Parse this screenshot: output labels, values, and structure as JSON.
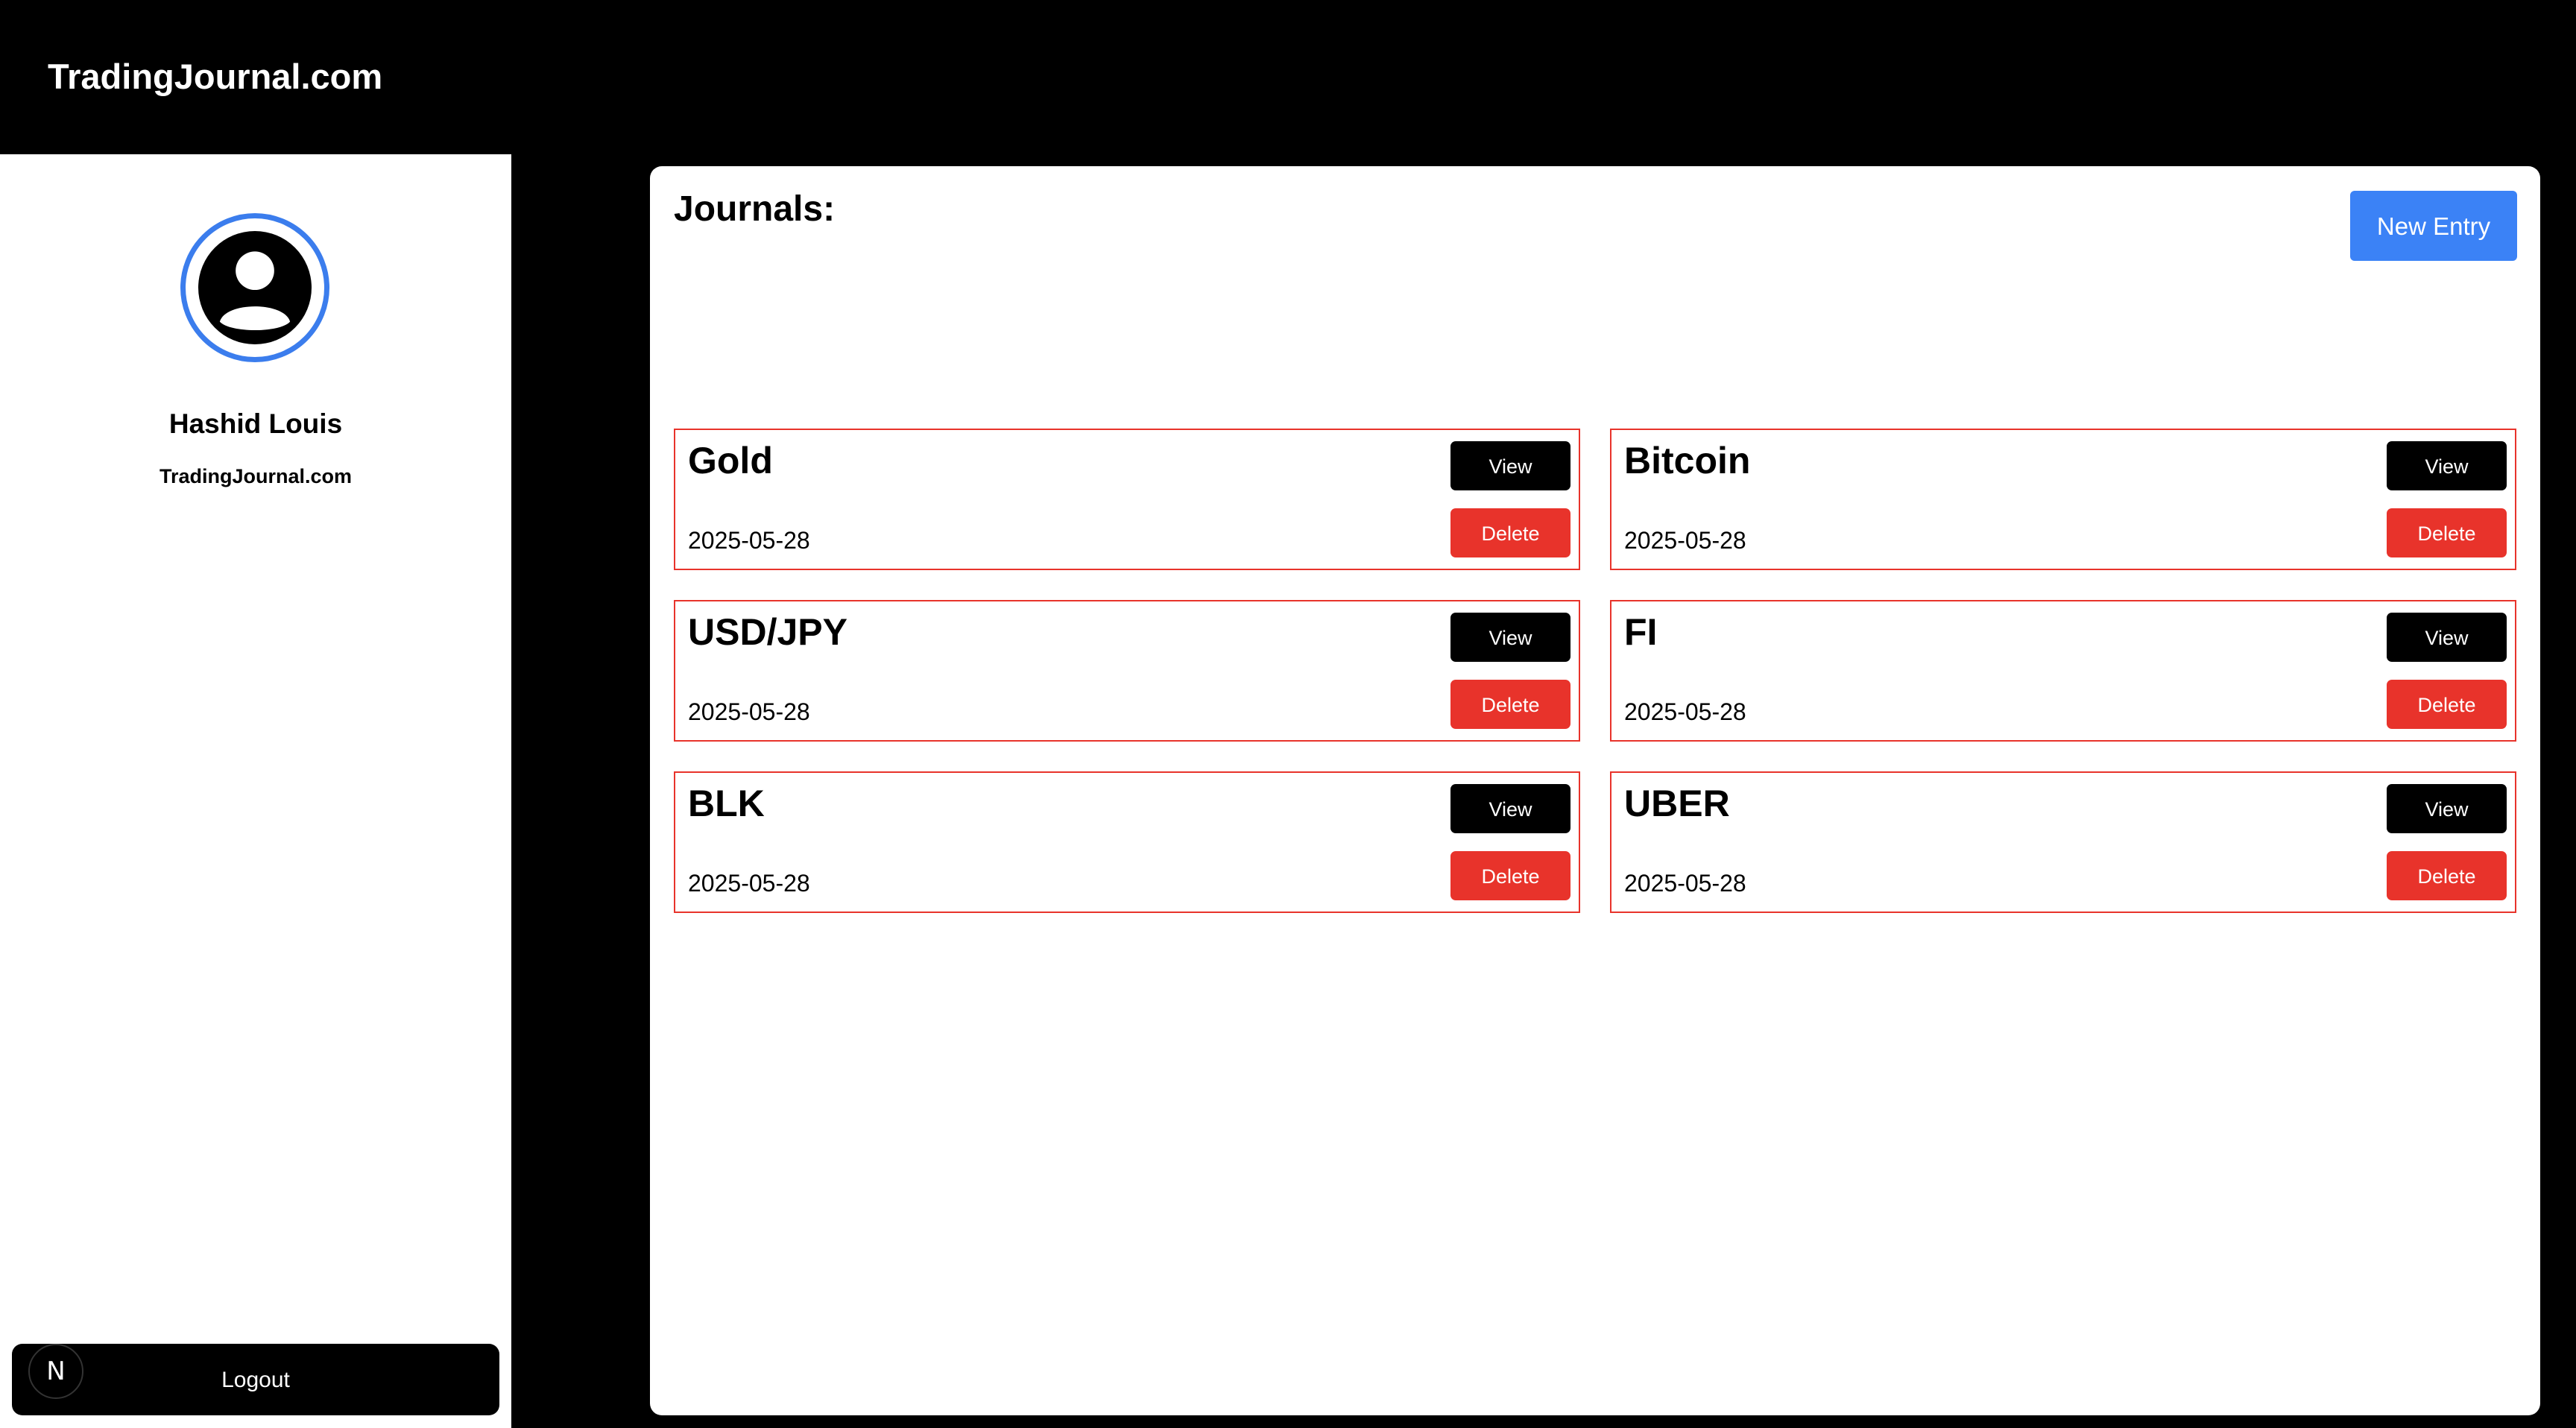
{
  "header": {
    "brand": "TradingJournal.com"
  },
  "sidebar": {
    "user_name": "Hashid Louis",
    "site": "TradingJournal.com",
    "logout_label": "Logout",
    "badge_letter": "N",
    "avatar_icon": "user-circle-icon"
  },
  "main": {
    "title": "Journals:",
    "new_entry_label": "New Entry",
    "view_label": "View",
    "delete_label": "Delete",
    "journals": [
      {
        "name": "Gold",
        "date": "2025-05-28"
      },
      {
        "name": "Bitcoin",
        "date": "2025-05-28"
      },
      {
        "name": "USD/JPY",
        "date": "2025-05-28"
      },
      {
        "name": "FI",
        "date": "2025-05-28"
      },
      {
        "name": "BLK",
        "date": "2025-05-28"
      },
      {
        "name": "UBER",
        "date": "2025-05-28"
      }
    ]
  },
  "colors": {
    "accent_blue": "#3b82f6",
    "avatar_ring": "#3b7ded",
    "danger_red": "#e8332b",
    "background": "#000000"
  }
}
